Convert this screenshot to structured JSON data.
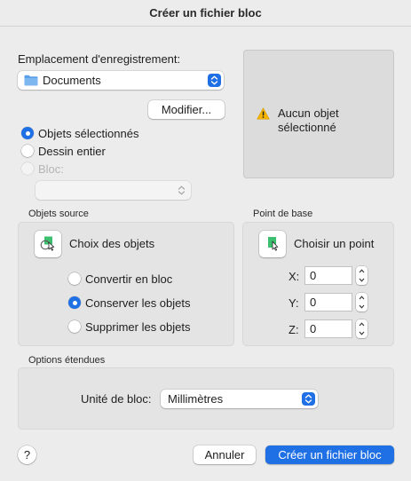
{
  "window": {
    "title": "Créer un fichier bloc"
  },
  "save_location": {
    "label": "Emplacement d'enregistrement:",
    "selected": "Documents",
    "icon": "folder-icon",
    "modify_button": "Modifier..."
  },
  "preview": {
    "icon": "warning-icon",
    "message": "Aucun objet sélectionné"
  },
  "source_choice": {
    "options": [
      {
        "label": "Objets sélectionnés",
        "selected": true,
        "enabled": true
      },
      {
        "label": "Dessin entier",
        "selected": false,
        "enabled": true
      },
      {
        "label": "Bloc:",
        "selected": false,
        "enabled": false
      }
    ],
    "block_select_value": ""
  },
  "source_objects": {
    "title": "Objets source",
    "choose_button": "Choix des objets",
    "options": [
      {
        "label": "Convertir en bloc",
        "selected": false
      },
      {
        "label": "Conserver les objets",
        "selected": true
      },
      {
        "label": "Supprimer les objets",
        "selected": false
      }
    ]
  },
  "base_point": {
    "title": "Point de base",
    "choose_button": "Choisir un point",
    "x_label": "X:",
    "x_value": "0",
    "y_label": "Y:",
    "y_value": "0",
    "z_label": "Z:",
    "z_value": "0"
  },
  "extended_options": {
    "title": "Options étendues",
    "unit_label": "Unité de bloc:",
    "unit_value": "Millimètres"
  },
  "footer": {
    "help": "?",
    "cancel": "Annuler",
    "create": "Créer un fichier bloc"
  },
  "colors": {
    "accent": "#1f6fe5",
    "window_bg": "#ececec",
    "warning": "#f5b400",
    "folder": "#5aa0e8",
    "green_icon": "#3cbf6e"
  }
}
